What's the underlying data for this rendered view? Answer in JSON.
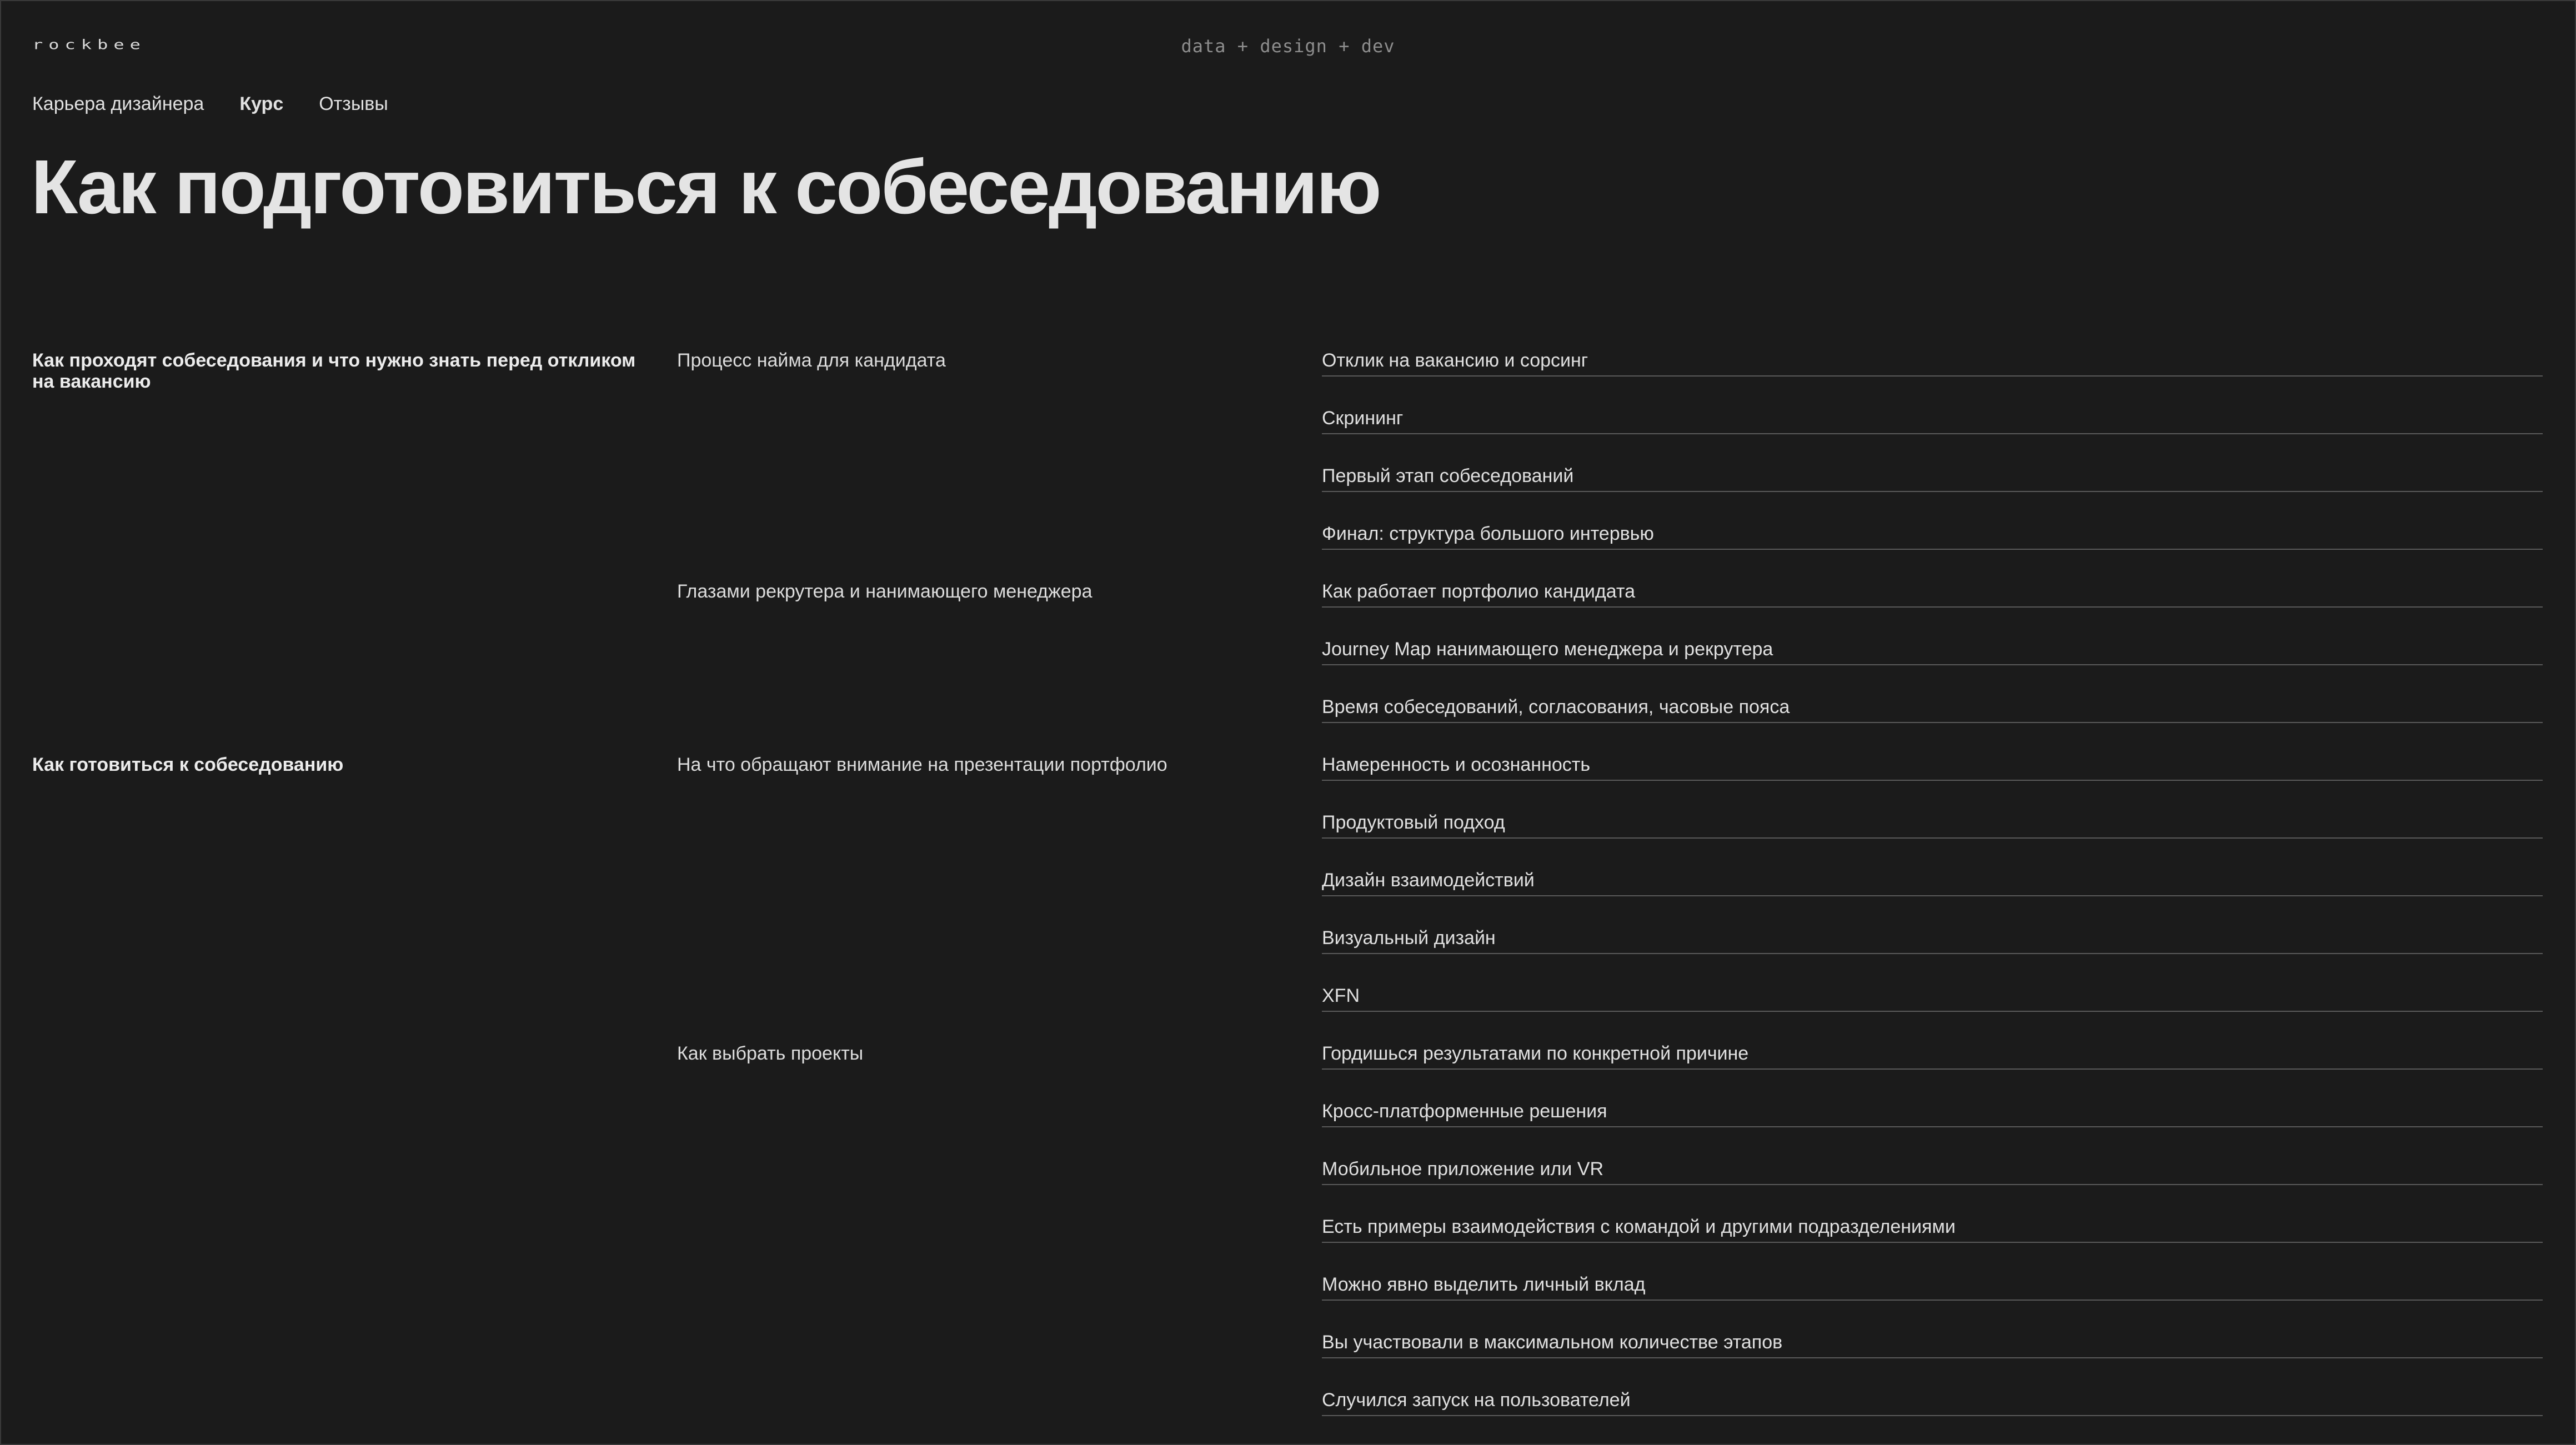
{
  "header": {
    "logo": "rockbee",
    "tagline": "data + design + dev"
  },
  "nav": {
    "items": [
      {
        "label": "Карьера  дизайнера",
        "active": false
      },
      {
        "label": "Курс",
        "active": true
      },
      {
        "label": "Отзывы",
        "active": false
      }
    ]
  },
  "page_title": "Как подготовиться к собеседованию",
  "sections": [
    {
      "title": "Как проходят собеседования и что нужно знать перед откликом на вакансию",
      "subsections": [
        {
          "title": "Процесс найма для кандидата",
          "topics": [
            "Отклик на вакансию и сорсинг",
            "Скрининг",
            "Первый этап собеседований",
            "Финал: структура большого интервью"
          ]
        },
        {
          "title": "Глазами рекрутера и нанимающего менеджера",
          "topics": [
            "Как работает портфолио кандидата",
            "Journey Map нанимающего менеджера и рекрутера",
            "Время собеседований, согласования, часовые пояса"
          ]
        }
      ]
    },
    {
      "title": "Как готовиться к собеседованию",
      "subsections": [
        {
          "title": "На что обращают внимание на презентации портфолио",
          "topics": [
            "Намеренность и осознанность",
            "Продуктовый подход",
            "Дизайн взаимодействий",
            "Визуальный дизайн",
            "XFN"
          ]
        },
        {
          "title": "Как выбрать проекты",
          "topics": [
            "Гордишься результатами по конкретной причине",
            "Кросс-платформенные решения",
            "Мобильное приложение или VR",
            "Есть примеры взаимодействия с командой и другими подразделениями",
            "Можно явно выделить личный вклад",
            "Вы участвовали в максимальном количестве этапов",
            "Случился запуск на пользователей"
          ]
        }
      ]
    }
  ]
}
